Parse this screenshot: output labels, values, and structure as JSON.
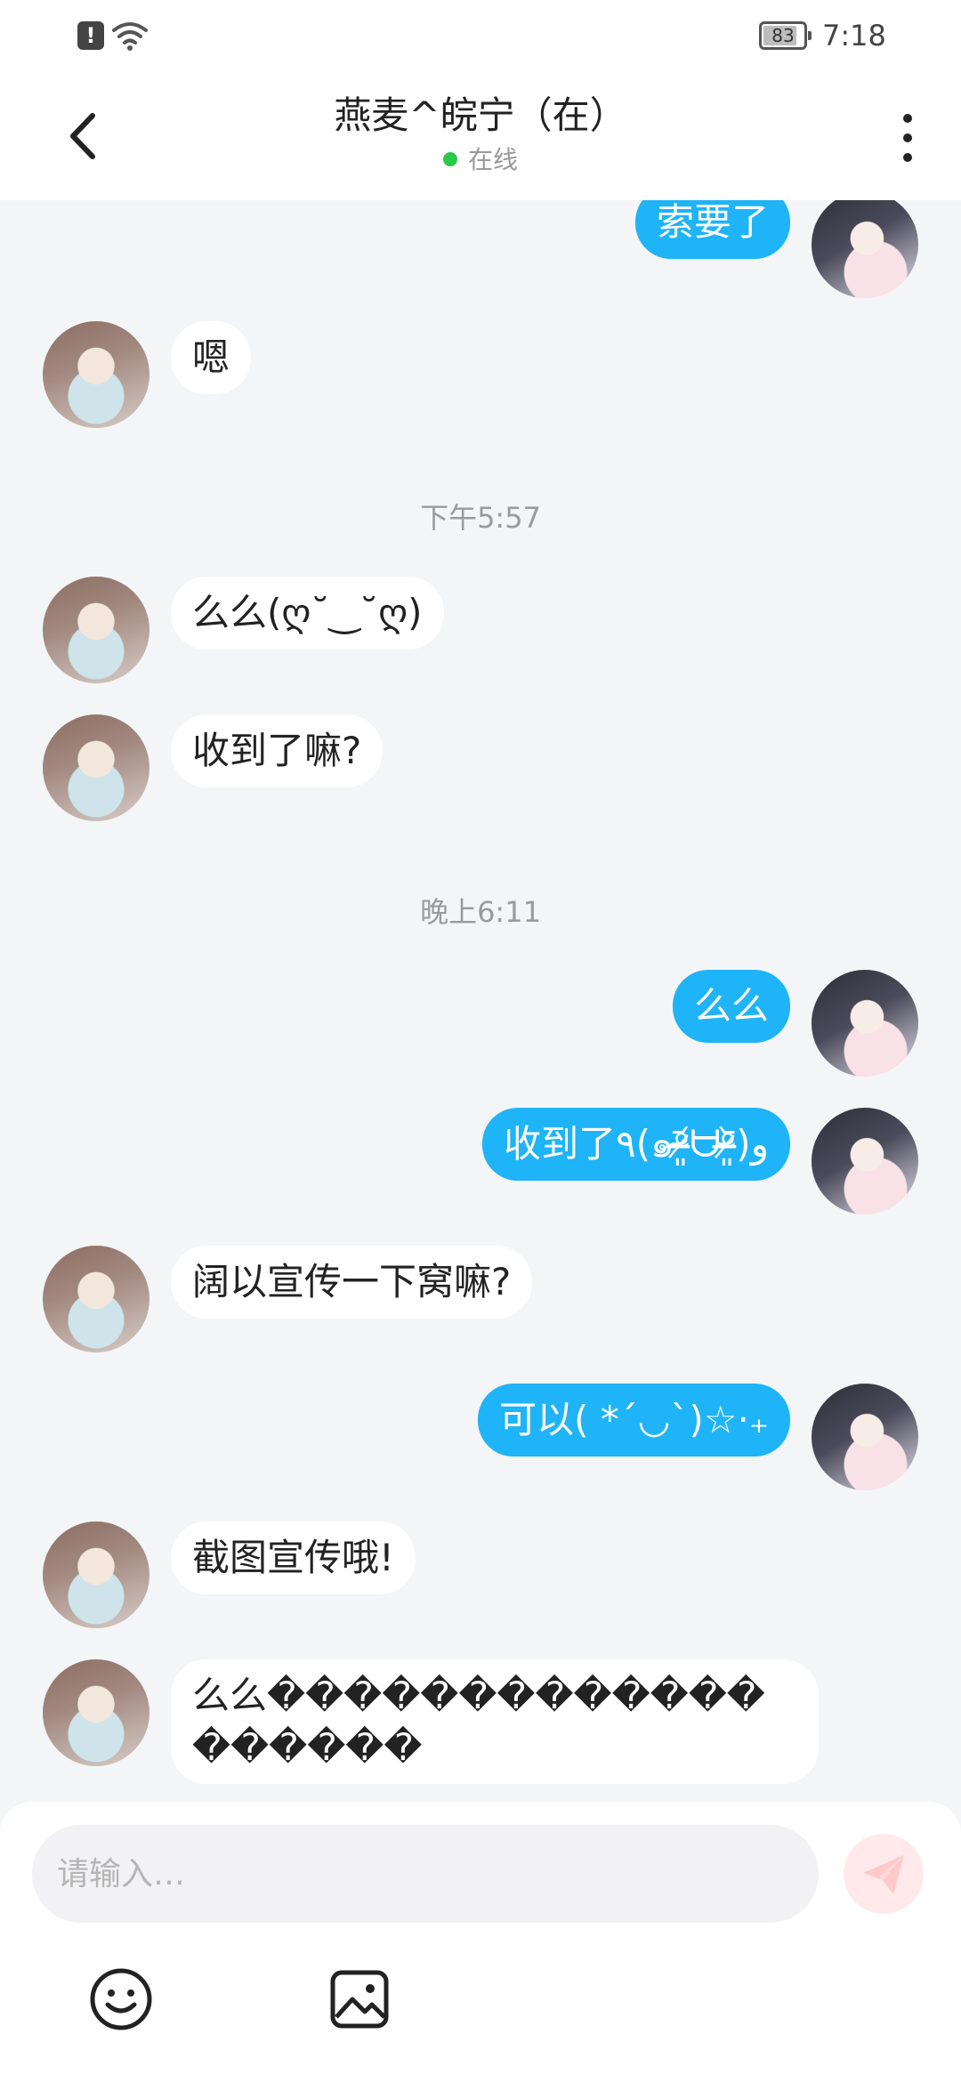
{
  "status_bar": {
    "battery": "83",
    "battery_level": 0.83,
    "time": "7:18",
    "alert_glyph": "!",
    "icons": [
      "alert-icon",
      "wifi-icon",
      "battery-icon"
    ]
  },
  "header": {
    "title": "燕麦^皖宁（在）",
    "status": "在线",
    "icons": [
      "back-arrow-icon",
      "more-vertical-icon"
    ]
  },
  "timestamps": [
    "下午5:57",
    "晚上6:11"
  ],
  "messages": [
    {
      "from": "self",
      "text": "索要了"
    },
    {
      "from": "friend",
      "text": "嗯"
    },
    {
      "from": "friend",
      "text": "么么(ღ˘‿˘ღ)"
    },
    {
      "from": "friend",
      "text": "收到了嘛?"
    },
    {
      "from": "self",
      "text": "么么"
    },
    {
      "from": "self",
      "text": "收到了٩(๑ᵒ̴̶̷͈᷄ᗨᵒ̴̶̷͈᷅)و"
    },
    {
      "from": "friend",
      "text": "阔以宣传一下窝嘛?"
    },
    {
      "from": "self",
      "text": "可以( *´◡`)☆·₊"
    },
    {
      "from": "friend",
      "text": "截图宣传哦!"
    },
    {
      "from": "friend",
      "text": "么么�������������������"
    }
  ],
  "input": {
    "placeholder": "请输入…",
    "value": ""
  },
  "toolbar": {
    "icons": [
      "send-icon",
      "emoji-icon",
      "image-icon"
    ]
  },
  "colors": {
    "self_bubble": "#1eb4f7",
    "friend_bubble": "#ffffff",
    "background": "#f4f5f7",
    "online": "#2ac94a",
    "send_button": "#ffe9ea"
  }
}
